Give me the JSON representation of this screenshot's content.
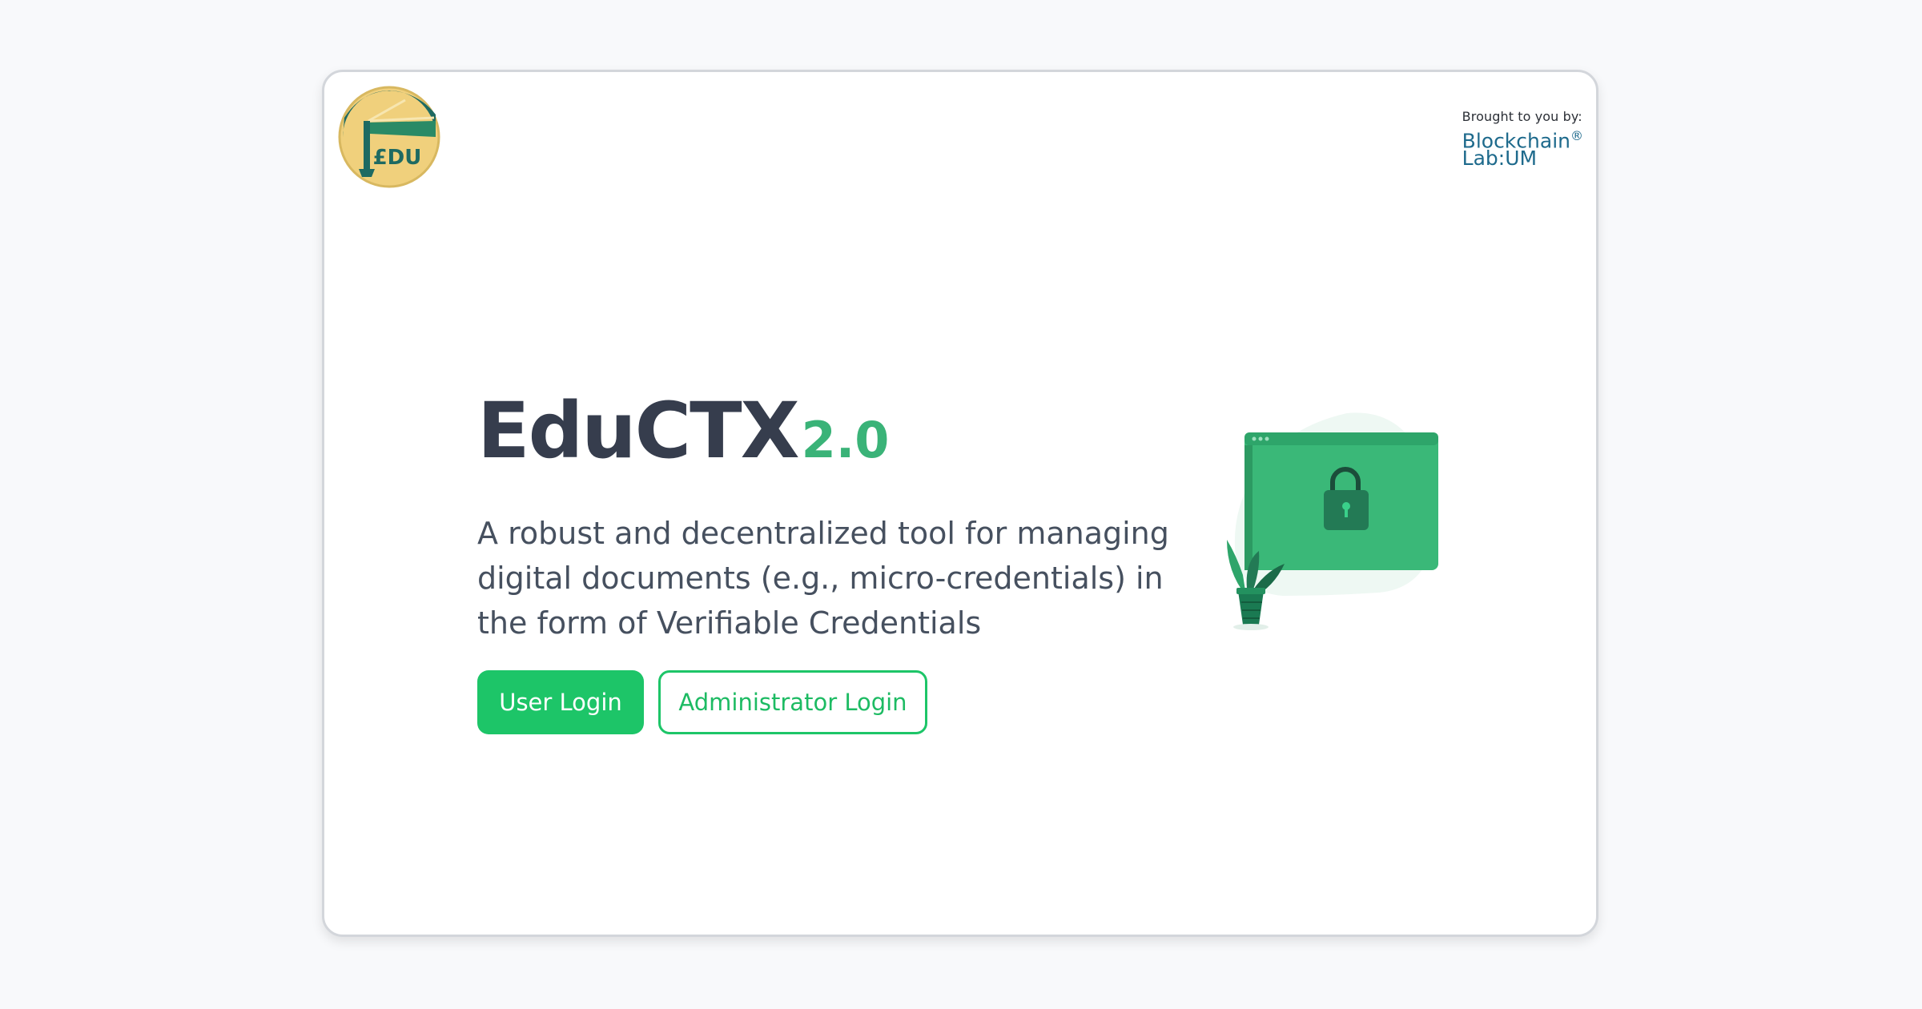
{
  "logo": {
    "text": "£DU",
    "icon": "graduation-cap-icon"
  },
  "brand": {
    "by": "Brought to you by:",
    "line1": "Blockchain",
    "trademark": "®",
    "line2": "Lab:UM"
  },
  "hero": {
    "title": "EduCTX",
    "version": "2.0",
    "subtitle": "A robust and decentralized tool for managing digital documents (e.g., micro-credentials) in the form of Verifiable Credentials"
  },
  "buttons": {
    "user_login": "User Login",
    "admin_login": "Administrator Login"
  },
  "illustration": {
    "icon": "padlock-screen-icon",
    "plant": "potted-plant-icon"
  },
  "colors": {
    "accent": "#1dc568",
    "title": "#363d4d",
    "version": "#3ab378",
    "brand": "#1e6a8c",
    "logo_teal": "#1e6a62",
    "logo_gold": "#f0d07c"
  }
}
